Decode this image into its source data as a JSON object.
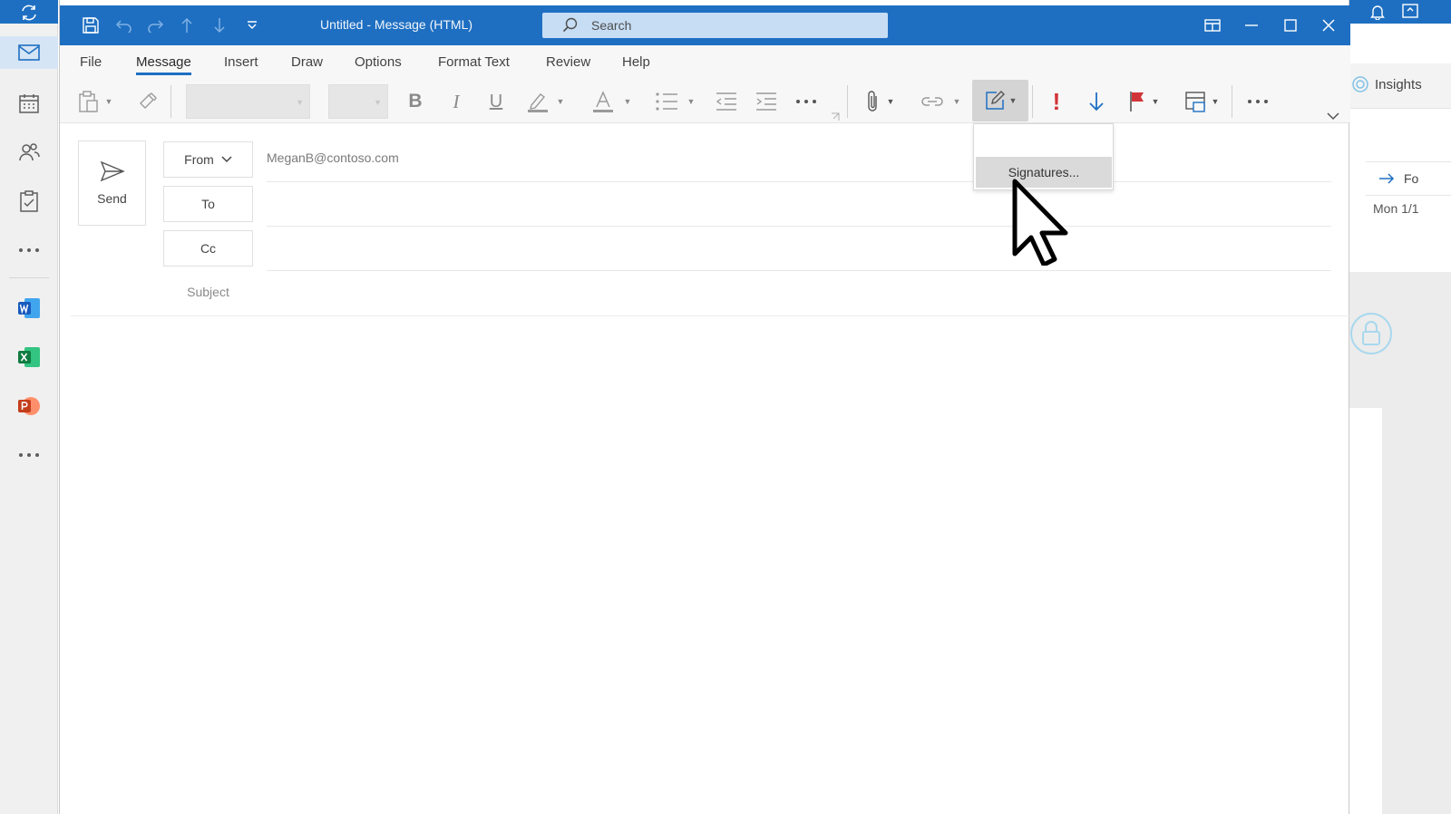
{
  "window": {
    "title": "Untitled - Message (HTML)",
    "search_placeholder": "Search"
  },
  "menu": {
    "tabs": [
      "File",
      "Message",
      "Insert",
      "Draw",
      "Options",
      "Format Text",
      "Review",
      "Help"
    ],
    "active_tab": "Message"
  },
  "ribbon": {
    "signature_menu": {
      "items": [
        "Signatures..."
      ]
    }
  },
  "compose": {
    "send_label": "Send",
    "from_label": "From",
    "from_value": "MeganB@contoso.com",
    "to_label": "To",
    "cc_label": "Cc",
    "subject_label": "Subject"
  },
  "background_window": {
    "insights_label": "Insights",
    "forward_label": "Fo",
    "date_label": "Mon 1/1"
  },
  "colors": {
    "accent": "#1e6fc2",
    "importance_high": "#d13438",
    "importance_low": "#1e6fc2",
    "flag": "#d13438"
  }
}
